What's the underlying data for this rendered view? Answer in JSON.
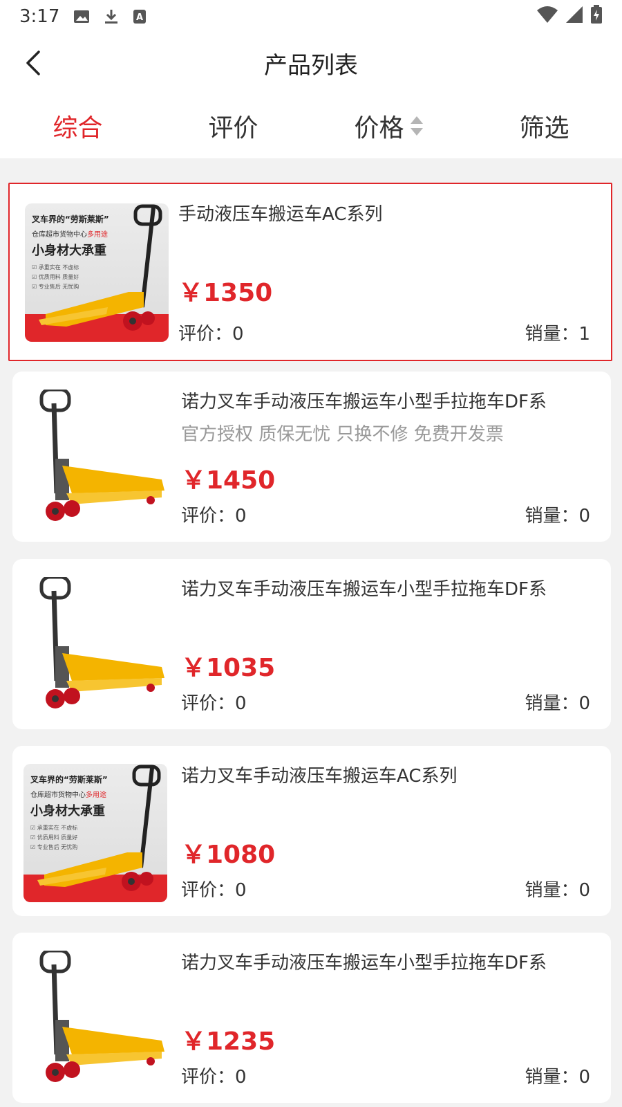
{
  "status_bar": {
    "time": "3:17"
  },
  "header": {
    "title": "产品列表"
  },
  "tabs": [
    {
      "label": "综合",
      "active": true
    },
    {
      "label": "评价",
      "active": false
    },
    {
      "label": "价格",
      "active": false
    },
    {
      "label": "筛选",
      "active": false
    }
  ],
  "poster": {
    "line1": "叉车界的“劳斯莱斯”",
    "line2_a": "仓库超市货物中心",
    "line2_b": "多用途",
    "line3": "小身材大承重",
    "check1": "承重实在 不虚标",
    "check2": "优质用料 质量好",
    "check3": "专业售后 无忧购"
  },
  "products": [
    {
      "name": "手动液压车搬运车AC系列",
      "subtitle": "",
      "price": "￥1350",
      "rating": "评价：0",
      "sales": "销量：1",
      "image": "poster",
      "selected": true
    },
    {
      "name": "诺力叉车手动液压车搬运车小型手拉拖车DF系",
      "subtitle": "官方授权 质保无忧 只换不修 免费开发票",
      "price": "￥1450",
      "rating": "评价：0",
      "sales": "销量：0",
      "image": "truck",
      "selected": false
    },
    {
      "name": "诺力叉车手动液压车搬运车小型手拉拖车DF系",
      "subtitle": "",
      "price": "￥1035",
      "rating": "评价：0",
      "sales": "销量：0",
      "image": "truck",
      "selected": false
    },
    {
      "name": "诺力叉车手动液压车搬运车AC系列",
      "subtitle": "",
      "price": "￥1080",
      "rating": "评价：0",
      "sales": "销量：0",
      "image": "poster",
      "selected": false
    },
    {
      "name": "诺力叉车手动液压车搬运车小型手拉拖车DF系",
      "subtitle": "",
      "price": "￥1235",
      "rating": "评价：0",
      "sales": "销量：0",
      "image": "truck",
      "selected": false
    }
  ],
  "colors": {
    "accent": "#e0262a",
    "text": "#333333",
    "muted": "#999999",
    "background": "#f2f2f2"
  }
}
